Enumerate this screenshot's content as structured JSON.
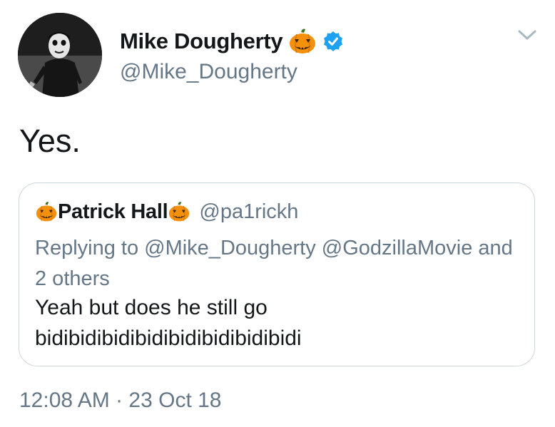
{
  "tweet": {
    "display_name": "Mike Dougherty",
    "handle": "@Mike_Dougherty",
    "text": "Yes.",
    "timestamp": "12:08 AM · 23 Oct 18",
    "verified": true
  },
  "quoted_tweet": {
    "display_name": "Patrick Hall",
    "handle": "@pa1rickh",
    "replying_to": "Replying to @Mike_Dougherty @GodzillaMovie and 2 others",
    "text_line1": "Yeah but does he still go",
    "text_line2": "bidibidibidibidibidibidibidibidi"
  },
  "colors": {
    "text_primary": "#14171a",
    "text_secondary": "#657786",
    "verified_blue": "#1da1f2",
    "border": "#ccd6dd",
    "pumpkin_orange": "#f4900c"
  },
  "icons": {
    "avatar": "avatar-image",
    "name_emoji": "jack-o-lantern-icon",
    "verified": "verified-badge-icon",
    "menu": "chevron-down-icon"
  }
}
